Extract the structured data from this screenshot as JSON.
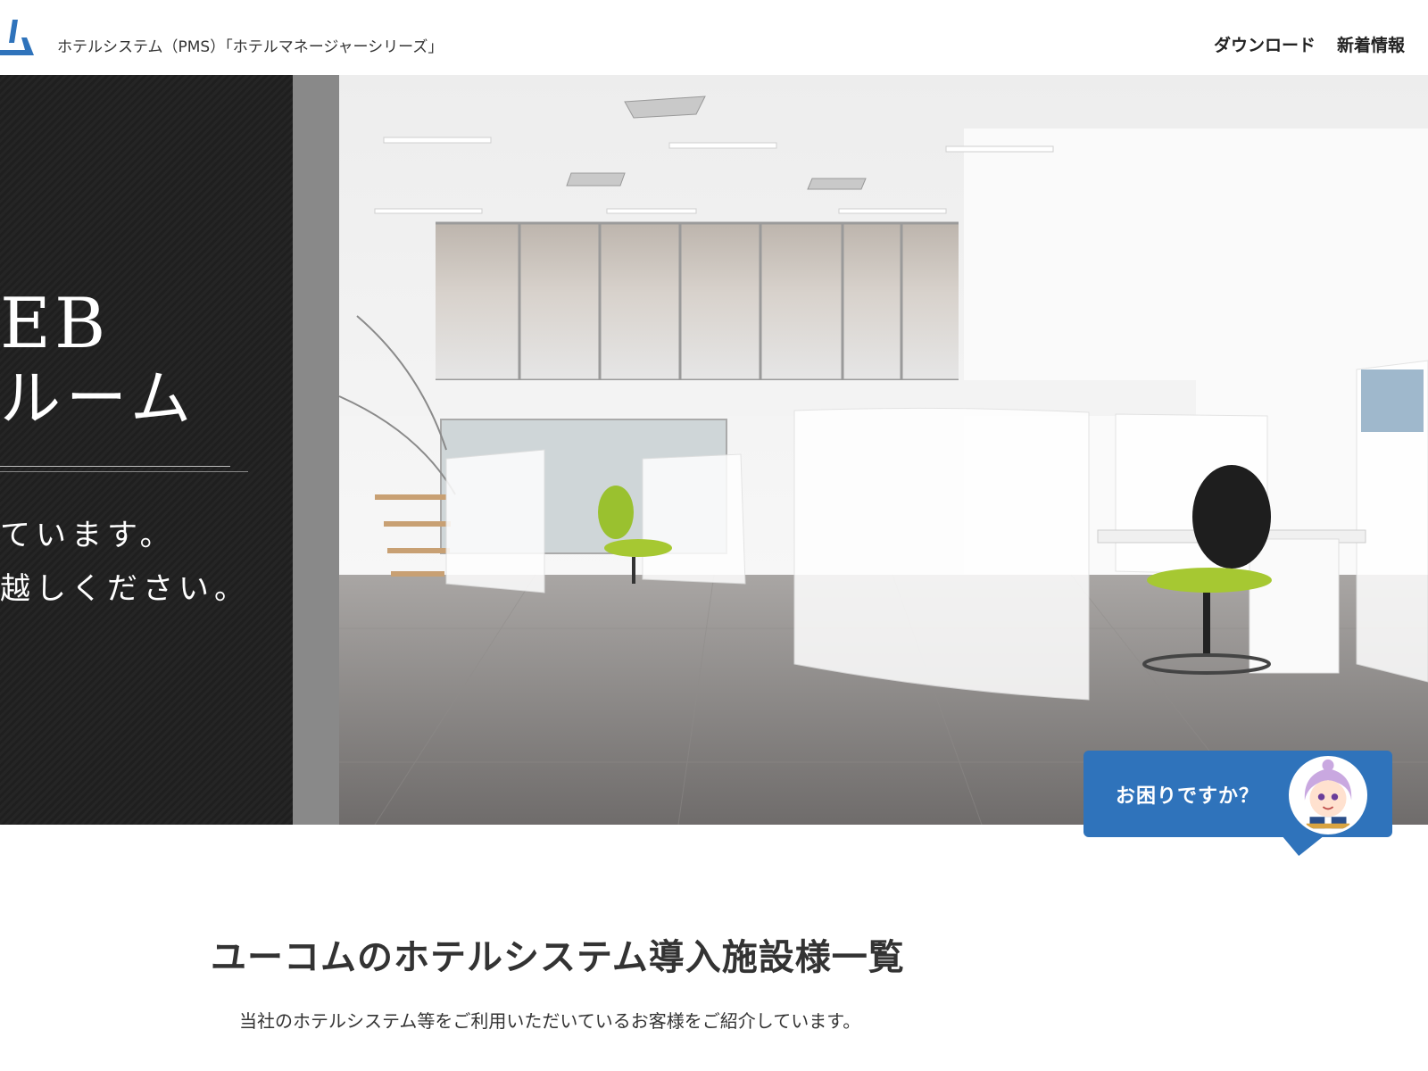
{
  "header": {
    "logo_icon": "company-logo-icon",
    "tagline": "ホテルシステム（PMS）「ホテルマネージャーシリーズ」",
    "nav": [
      {
        "label": "ダウンロード"
      },
      {
        "label": "新着情報"
      }
    ]
  },
  "hero": {
    "line1": "EB",
    "line2": "ルーム",
    "sub1": "ています。",
    "sub2": "越しください。"
  },
  "help": {
    "label": "お困りですか？",
    "avatar_icon": "support-character-icon"
  },
  "main": {
    "title": "ユーコムのホテルシステム導入施設様一覧",
    "description": "当社のホテルシステム等をご利用いただいているお客様をご紹介しています。"
  },
  "colors": {
    "brand_blue": "#2f73bb",
    "dark_panel": "#222222",
    "lime_chair": "#a6c832"
  }
}
